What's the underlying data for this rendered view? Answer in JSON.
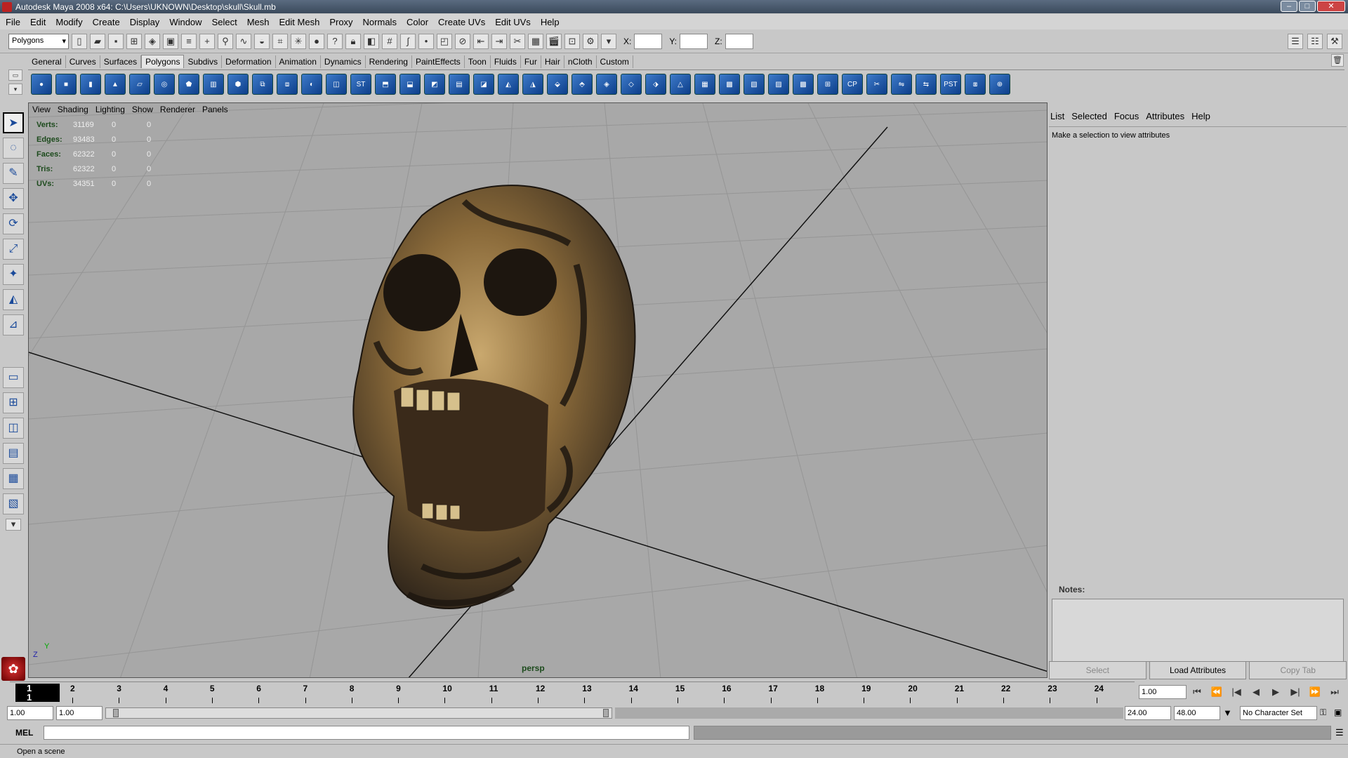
{
  "window": {
    "title": "Autodesk Maya 2008 x64: C:\\Users\\UKNOWN\\Desktop\\skull\\Skull.mb"
  },
  "menubar": [
    "File",
    "Edit",
    "Modify",
    "Create",
    "Display",
    "Window",
    "Select",
    "Mesh",
    "Edit Mesh",
    "Proxy",
    "Normals",
    "Color",
    "Create UVs",
    "Edit UVs",
    "Help"
  ],
  "statusline": {
    "menuset": "Polygons",
    "x_label": "X:",
    "y_label": "Y:",
    "z_label": "Z:"
  },
  "shelf": {
    "tabs": [
      "General",
      "Curves",
      "Surfaces",
      "Polygons",
      "Subdivs",
      "Deformation",
      "Animation",
      "Dynamics",
      "Rendering",
      "PaintEffects",
      "Toon",
      "Fluids",
      "Fur",
      "Hair",
      "nCloth",
      "Custom"
    ],
    "active_tab": "Polygons",
    "icon_labels": {
      "st": "ST",
      "cp": "CP",
      "pst": "PST"
    }
  },
  "viewport": {
    "menu": [
      "View",
      "Shading",
      "Lighting",
      "Show",
      "Renderer",
      "Panels"
    ],
    "hud": [
      {
        "label": "Verts:",
        "v1": "31169",
        "v2": "0",
        "v3": "0"
      },
      {
        "label": "Edges:",
        "v1": "93483",
        "v2": "0",
        "v3": "0"
      },
      {
        "label": "Faces:",
        "v1": "62322",
        "v2": "0",
        "v3": "0"
      },
      {
        "label": "Tris:",
        "v1": "62322",
        "v2": "0",
        "v3": "0"
      },
      {
        "label": "UVs:",
        "v1": "34351",
        "v2": "0",
        "v3": "0"
      }
    ],
    "camera": "persp",
    "axis_y": "Y",
    "axis_z": "Z"
  },
  "attribute_editor": {
    "menu": [
      "List",
      "Selected",
      "Focus",
      "Attributes",
      "Help"
    ],
    "message": "Make a selection to view attributes",
    "notes_label": "Notes:",
    "buttons": {
      "select": "Select",
      "load": "Load Attributes",
      "copy": "Copy Tab"
    }
  },
  "timeline": {
    "current_frame": "1",
    "current_frame_sub": "1",
    "ticks": [
      "2",
      "3",
      "4",
      "5",
      "6",
      "7",
      "8",
      "9",
      "10",
      "11",
      "12",
      "13",
      "14",
      "15",
      "16",
      "17",
      "18",
      "19",
      "20",
      "21",
      "22",
      "23",
      "24"
    ],
    "frame_field": "1.00"
  },
  "range": {
    "start": "1.00",
    "start2": "1.00",
    "end": "24.00",
    "end2": "48.00",
    "character_set": "No Character Set"
  },
  "cmdline": {
    "label": "MEL"
  },
  "helpline": {
    "text": "Open a scene"
  }
}
